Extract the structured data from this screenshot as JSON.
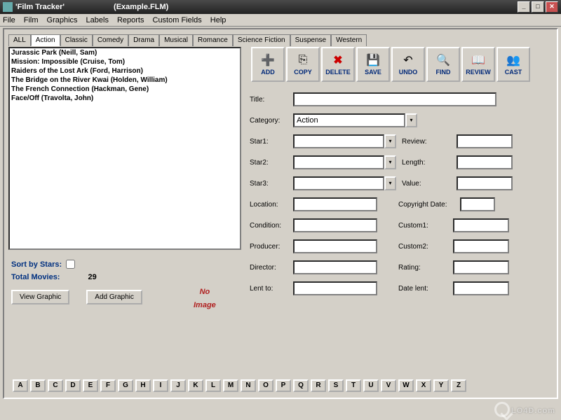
{
  "window": {
    "app_title": "'Film Tracker'",
    "file_title": "(Example.FLM)",
    "min": "_",
    "max": "□",
    "close": "✕"
  },
  "menu": [
    "File",
    "Film",
    "Graphics",
    "Labels",
    "Reports",
    "Custom Fields",
    "Help"
  ],
  "tabs": [
    "ALL",
    "Action",
    "Classic",
    "Comedy",
    "Drama",
    "Musical",
    "Romance",
    "Science Fiction",
    "Suspense",
    "Western"
  ],
  "active_tab": 1,
  "films": [
    "Jurassic Park (Neill, Sam)",
    "Mission: Impossible (Cruise, Tom)",
    "Raiders of the Lost Ark (Ford, Harrison)",
    "The Bridge on the River Kwai (Holden, William)",
    "The French Connection (Hackman, Gene)",
    "Face/Off (Travolta, John)"
  ],
  "left_panel": {
    "sort_label": "Sort by Stars:",
    "total_label": "Total Movies:",
    "total_count": "29",
    "view_graphic": "View Graphic",
    "add_graphic": "Add Graphic",
    "no_image_1": "No",
    "no_image_2": "Image"
  },
  "toolbar": [
    {
      "label": "ADD",
      "icon": "➕"
    },
    {
      "label": "COPY",
      "icon": "⎘"
    },
    {
      "label": "DELETE",
      "icon": "✖"
    },
    {
      "label": "SAVE",
      "icon": "💾"
    },
    {
      "label": "UNDO",
      "icon": "↶"
    },
    {
      "label": "FIND",
      "icon": "🔍"
    },
    {
      "label": "REVIEW",
      "icon": "📖"
    },
    {
      "label": "CAST",
      "icon": "👥"
    }
  ],
  "form": {
    "title_label": "Title:",
    "title_value": "",
    "category_label": "Category:",
    "category_value": "Action",
    "star1_label": "Star1:",
    "star1_value": "",
    "star2_label": "Star2:",
    "star2_value": "",
    "star3_label": "Star3:",
    "star3_value": "",
    "review_label": "Review:",
    "review_value": "",
    "length_label": "Length:",
    "length_value": "",
    "value_label": "Value:",
    "value_value": "",
    "location_label": "Location:",
    "location_value": "",
    "condition_label": "Condition:",
    "condition_value": "",
    "producer_label": "Producer:",
    "producer_value": "",
    "director_label": "Director:",
    "director_value": "",
    "lent_label": "Lent to:",
    "lent_value": "",
    "copyright_label": "Copyright Date:",
    "copyright_value": "",
    "custom1_label": "Custom1:",
    "custom1_value": "",
    "custom2_label": "Custom2:",
    "custom2_value": "",
    "rating_label": "Rating:",
    "rating_value": "",
    "datelent_label": "Date lent:",
    "datelent_value": ""
  },
  "alphabet": [
    "A",
    "B",
    "C",
    "D",
    "E",
    "F",
    "G",
    "H",
    "I",
    "J",
    "K",
    "L",
    "M",
    "N",
    "O",
    "P",
    "Q",
    "R",
    "S",
    "T",
    "U",
    "V",
    "W",
    "X",
    "Y",
    "Z"
  ],
  "watermark": "LO4D.com"
}
